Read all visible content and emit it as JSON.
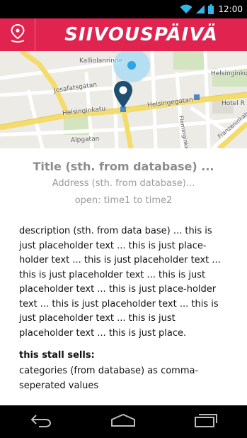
{
  "status_bar": {
    "time": "12:00",
    "icons": [
      "wifi-icon",
      "signal-icon",
      "battery-icon"
    ]
  },
  "header": {
    "brand": "SIIVOUSPÄIVÄ",
    "pin_icon": "location-pin-icon",
    "colors": {
      "accent": "#e0234f"
    }
  },
  "map": {
    "labels": {
      "kalliolanrinne": "Kalliolanrinne",
      "josafatsgatan": "Josafatsgatan",
      "helsinginkatu": "Helsinginkatu",
      "helsingegatan": "Helsingegatan",
      "helsinginku": "Helsinginku",
      "hotel": "Hotel R",
      "alpgatan": "Alpgatan",
      "flemingink": "Fleminginkatu",
      "franzenin": "Franzeninkatu"
    },
    "marker_icon": "map-marker-icon",
    "location_icon": "current-location-icon"
  },
  "stall": {
    "title": "Title (sth. from database) ...",
    "address": "Address (sth. from database)...",
    "open": "open: time1 to time2",
    "description": "description (sth. from data base) ... this is just placeholder text ... this is just place-holder text ... this is just placeholder text ... this is just placeholder text ... this is just placeholder text ... this is just place-holder text ... this is just placeholder text ... this is just placeholder text ... this is just placeholder text ... this is just place.",
    "sells_heading": "this stall sells:",
    "sells_body": "categories (from database) as comma-seperated values"
  },
  "nav": {
    "back_icon": "back-icon",
    "home_icon": "home-icon",
    "recents_icon": "recent-apps-icon"
  }
}
